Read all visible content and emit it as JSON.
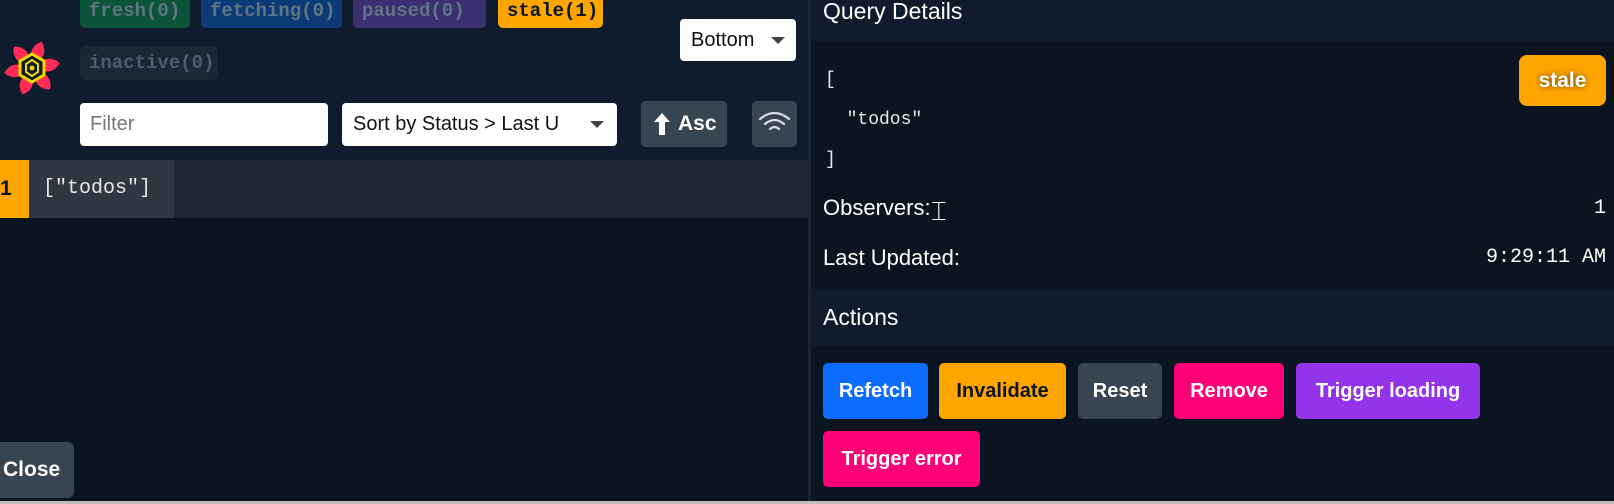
{
  "status_badges": [
    {
      "label": "fresh",
      "count": "(0)",
      "text": "fresh(0)",
      "color": "#0b5339"
    },
    {
      "label": "fetching",
      "count": "(0)",
      "text": "fetching(0)",
      "color": "#0b3a77"
    },
    {
      "label": "paused",
      "count": "(0)",
      "text": "paused(0)",
      "color": "#3b2f72"
    },
    {
      "label": "stale",
      "count": "(1)",
      "text": "stale(1)",
      "color": "#ffa500"
    },
    {
      "label": "inactive",
      "count": "(0)",
      "text": "inactive(0)",
      "color": "#1a2735"
    }
  ],
  "position_select": {
    "value": "Bottom"
  },
  "filter": {
    "placeholder": "Filter",
    "value": ""
  },
  "sort_select": {
    "value": "Sort by Status > Last U"
  },
  "sort_order_button": {
    "label": "Asc",
    "icon": "arrow-up-icon"
  },
  "network_toggle": {
    "icon": "wifi-icon"
  },
  "query_list": [
    {
      "observers": "1",
      "key": "[\"todos\"]",
      "status_color": "#ffa500"
    }
  ],
  "close_button": {
    "label": "Close"
  },
  "details": {
    "title": "Query Details",
    "query_key_lines": [
      "[",
      "  \"todos\"",
      "]"
    ],
    "status_pill": "stale",
    "observers_label": "Observers:",
    "observers_value": "1",
    "last_updated_label": "Last Updated:",
    "last_updated_value": "9:29:11 AM"
  },
  "actions": {
    "title": "Actions",
    "buttons": [
      {
        "label": "Refetch",
        "color": "#0b6cff"
      },
      {
        "label": "Invalidate",
        "color": "#ffa500"
      },
      {
        "label": "Reset",
        "color": "#374552"
      },
      {
        "label": "Remove",
        "color": "#ff0077"
      },
      {
        "label": "Trigger loading",
        "color": "#9333ea"
      },
      {
        "label": "Trigger error",
        "color": "#ff0077"
      }
    ]
  }
}
